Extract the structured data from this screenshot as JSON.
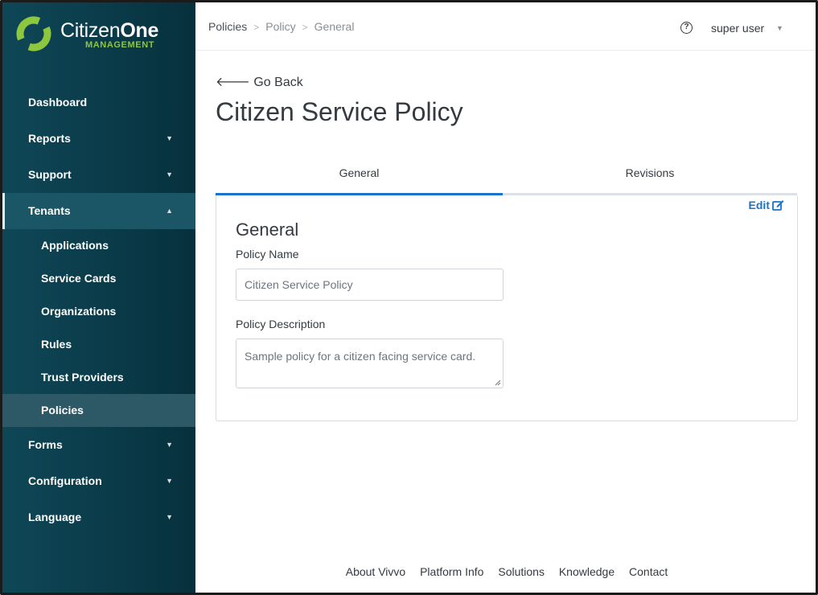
{
  "brand": {
    "name_regular": "Citizen",
    "name_bold": "One",
    "subtitle": "MANAGEMENT",
    "accent_color": "#8dc63f"
  },
  "sidebar": {
    "items": [
      {
        "label": "Dashboard"
      },
      {
        "label": "Reports"
      },
      {
        "label": "Support"
      },
      {
        "label": "Tenants"
      }
    ],
    "tenants_children": [
      {
        "label": "Applications"
      },
      {
        "label": "Service Cards"
      },
      {
        "label": "Organizations"
      },
      {
        "label": "Rules"
      },
      {
        "label": "Trust Providers"
      },
      {
        "label": "Policies"
      }
    ],
    "bottom_items": [
      {
        "label": "Forms"
      },
      {
        "label": "Configuration"
      },
      {
        "label": "Language"
      }
    ]
  },
  "header": {
    "breadcrumb": [
      "Policies",
      "Policy",
      "General"
    ],
    "help_icon": "question-circle-icon",
    "user": "super user"
  },
  "main": {
    "back_label": "Go Back",
    "title": "Citizen Service Policy",
    "tabs": [
      {
        "label": "General"
      },
      {
        "label": "Revisions"
      }
    ],
    "edit_label": "Edit",
    "section_title": "General",
    "fields": {
      "policy_name_label": "Policy Name",
      "policy_name_value": "Citizen Service Policy",
      "policy_description_label": "Policy Description",
      "policy_description_value": "Sample policy for a citizen facing service card."
    }
  },
  "footer": {
    "links": [
      "About Vivvo",
      "Platform Info",
      "Solutions",
      "Knowledge",
      "Contact"
    ]
  },
  "colors": {
    "sidebar_bg": "#0f4757",
    "link_blue": "#1a73c8"
  }
}
